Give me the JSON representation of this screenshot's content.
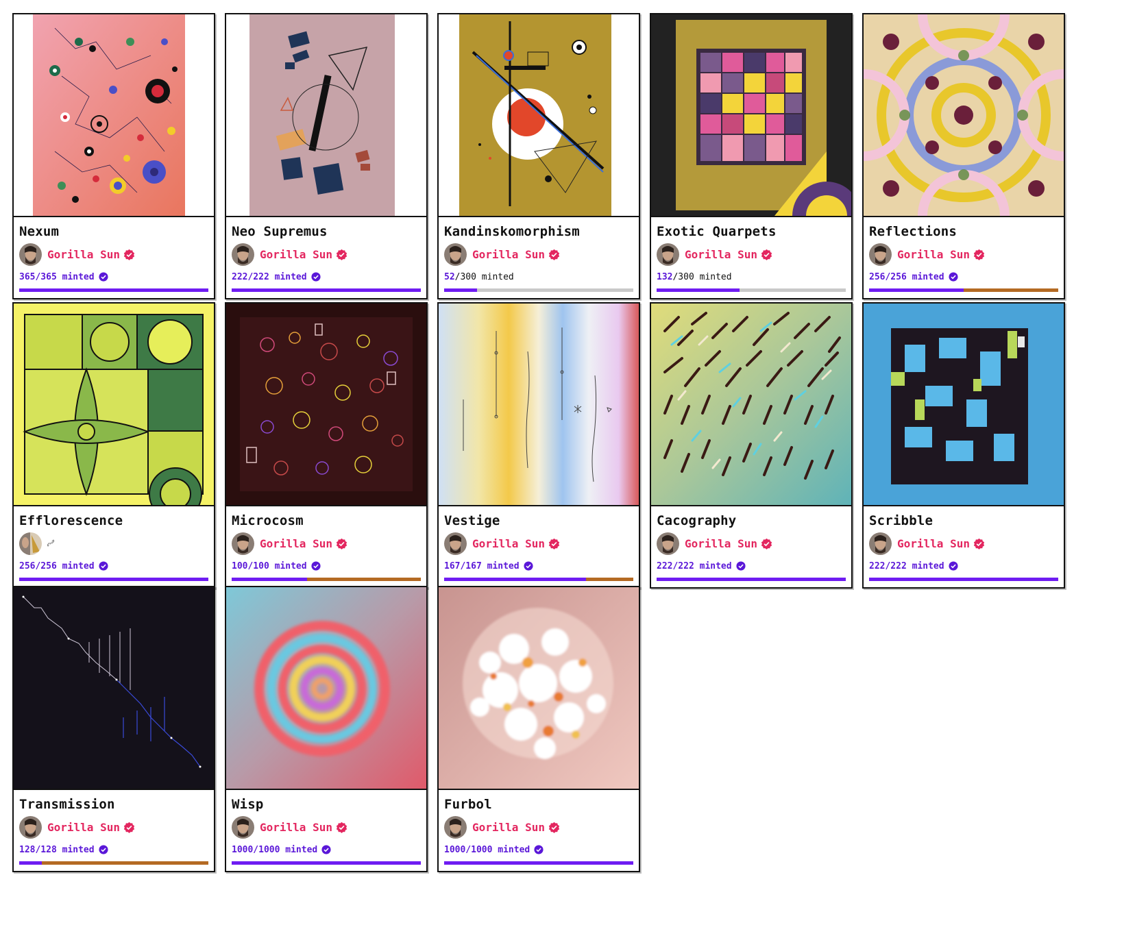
{
  "accent_color": "#e3265f",
  "minted_color": "#5a17d8",
  "bar_secondary_color": "#b46a23",
  "projects": [
    {
      "title": "Nexum",
      "artist": "Gorilla Sun",
      "verified": true,
      "minted_label": "365/365 minted",
      "complete": true,
      "progress": 1.0,
      "secondary_from": null
    },
    {
      "title": "Neo Supremus",
      "artist": "Gorilla Sun",
      "verified": true,
      "minted_label": "222/222 minted",
      "complete": true,
      "progress": 1.0,
      "secondary_from": null
    },
    {
      "title": "Kandinskomorphism",
      "artist": "Gorilla Sun",
      "verified": true,
      "minted_label": "52/300 minted",
      "complete": false,
      "progress": 0.173,
      "secondary_from": null
    },
    {
      "title": "Exotic Quarpets",
      "artist": "Gorilla Sun",
      "verified": true,
      "minted_label": "132/300 minted",
      "complete": false,
      "progress": 0.44,
      "secondary_from": null
    },
    {
      "title": "Reflections",
      "artist": "Gorilla Sun",
      "verified": true,
      "minted_label": "256/256 minted",
      "complete": true,
      "progress": 1.0,
      "secondary_from": 0.5
    },
    {
      "title": "Efflorescence",
      "artist": "",
      "verified": false,
      "collab": true,
      "minted_label": "256/256 minted",
      "complete": true,
      "progress": 1.0,
      "secondary_from": null
    },
    {
      "title": "Microcosm",
      "artist": "Gorilla Sun",
      "verified": true,
      "minted_label": "100/100 minted",
      "complete": true,
      "progress": 1.0,
      "secondary_from": 0.4
    },
    {
      "title": "Vestige",
      "artist": "Gorilla Sun",
      "verified": true,
      "minted_label": "167/167 minted",
      "complete": true,
      "progress": 1.0,
      "secondary_from": 0.75
    },
    {
      "title": "Cacography",
      "artist": "Gorilla Sun",
      "verified": true,
      "minted_label": "222/222 minted",
      "complete": true,
      "progress": 1.0,
      "secondary_from": null
    },
    {
      "title": "Scribble",
      "artist": "Gorilla Sun",
      "verified": true,
      "minted_label": "222/222 minted",
      "complete": true,
      "progress": 1.0,
      "secondary_from": null
    },
    {
      "title": "Transmission",
      "artist": "Gorilla Sun",
      "verified": true,
      "minted_label": "128/128 minted",
      "complete": true,
      "progress": 1.0,
      "secondary_from": 0.12
    },
    {
      "title": "Wisp",
      "artist": "Gorilla Sun",
      "verified": true,
      "minted_label": "1000/1000 minted",
      "complete": true,
      "progress": 1.0,
      "secondary_from": null
    },
    {
      "title": "Furbol",
      "artist": "Gorilla Sun",
      "verified": true,
      "minted_label": "1000/1000 minted",
      "complete": true,
      "progress": 1.0,
      "secondary_from": null
    }
  ]
}
